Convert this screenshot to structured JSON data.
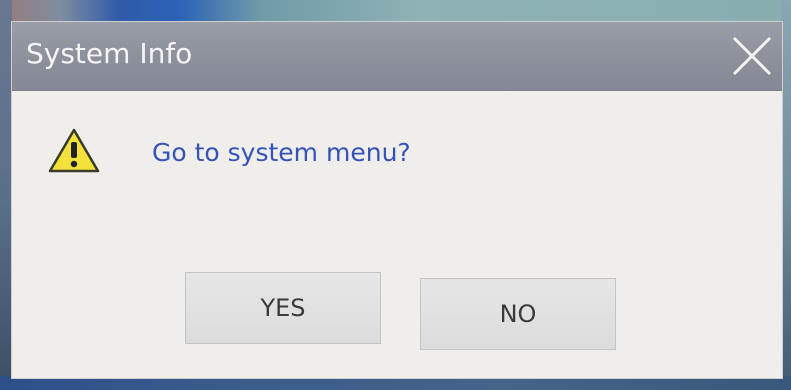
{
  "dialog": {
    "title": "System Info",
    "message": "Go to system menu?",
    "buttons": {
      "yes_label": "YES",
      "no_label": "NO"
    },
    "icons": {
      "warning": "warning-icon",
      "close": "close-icon"
    }
  },
  "colors": {
    "titlebar": "#8c909b",
    "dialog_bg": "#efeeeb",
    "message_text": "#3552b8",
    "warning_fill": "#f2e23a",
    "button_bg": "#e0e0e0"
  }
}
